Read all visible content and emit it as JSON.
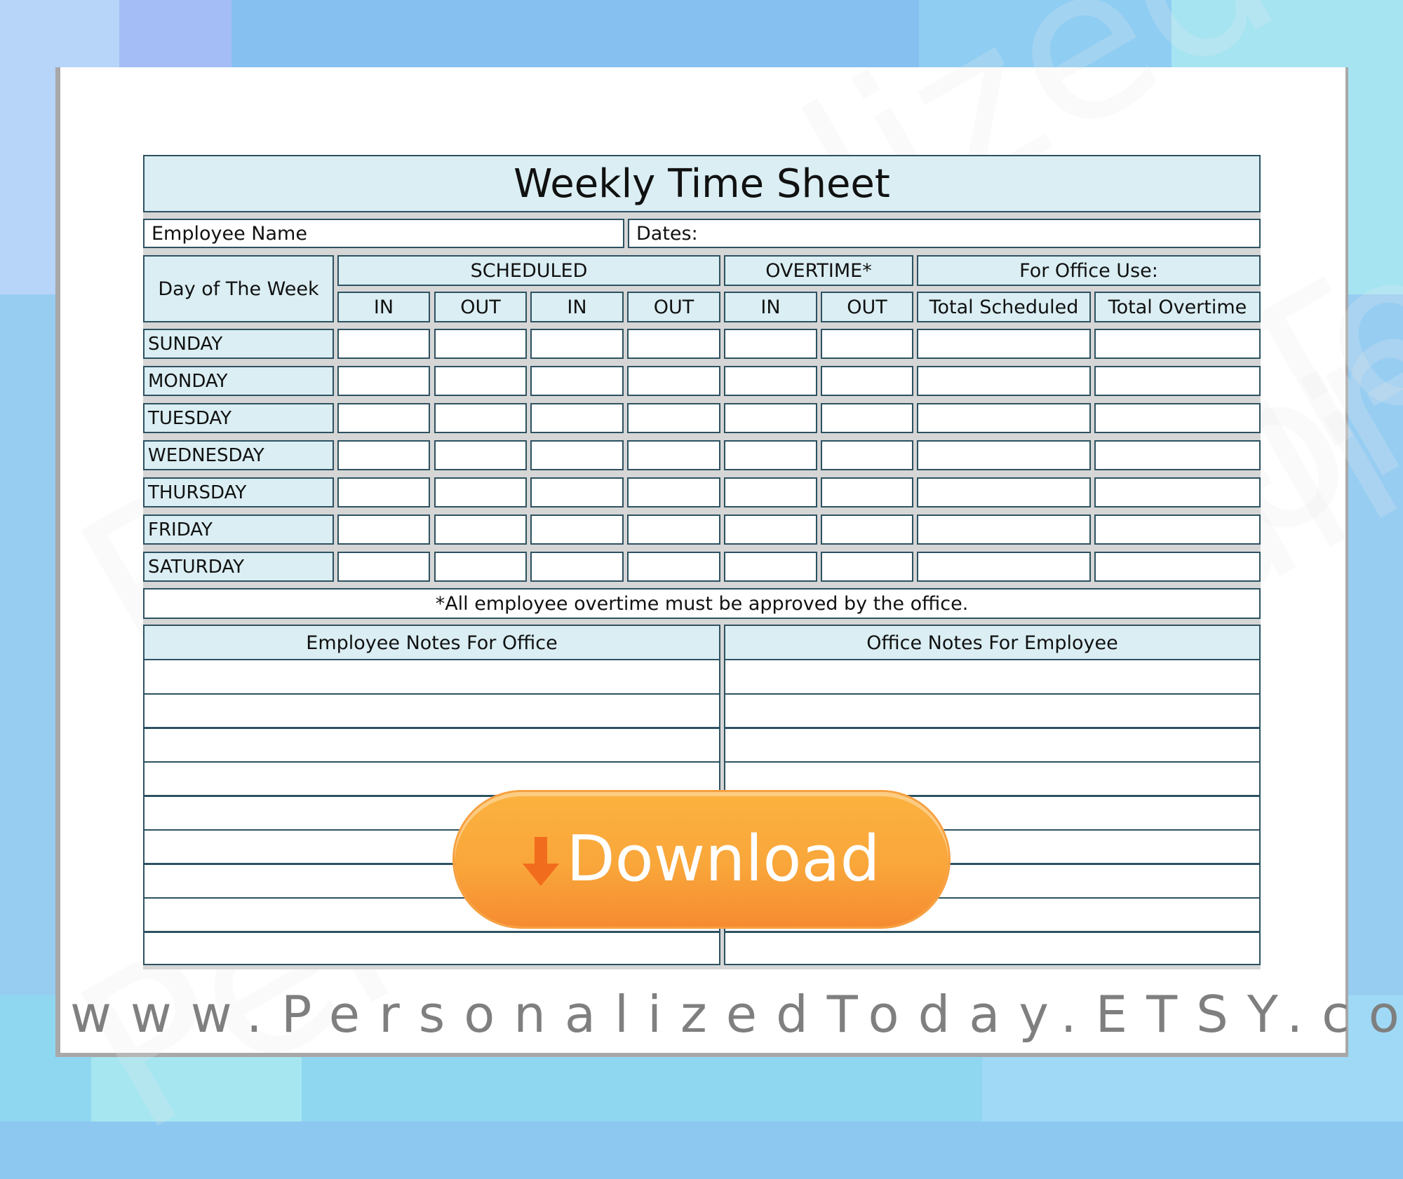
{
  "sheet": {
    "title": "Weekly Time Sheet",
    "employee_name_label": "Employee Name",
    "dates_label": "Dates:",
    "day_header": "Day of The Week",
    "groups": {
      "scheduled": "SCHEDULED",
      "overtime": "OVERTIME*",
      "office_use": "For Office Use:"
    },
    "columns": [
      "IN",
      "OUT",
      "IN",
      "OUT",
      "IN",
      "OUT",
      "Total Scheduled",
      "Total Overtime"
    ],
    "days": [
      "SUNDAY",
      "MONDAY",
      "TUESDAY",
      "WEDNESDAY",
      "THURSDAY",
      "FRIDAY",
      "SATURDAY"
    ],
    "footnote": "*All employee overtime must be approved by the office.",
    "notes": {
      "left_header": "Employee Notes For Office",
      "right_header": "Office Notes For Employee",
      "line_count": 9
    }
  },
  "download_button": {
    "label": "Download",
    "icon": "download-arrow-icon",
    "color": "#f9a63a",
    "arrow_color": "#f26c1d"
  },
  "watermark": "PersonalizedToday",
  "footer_url": "www.PersonalizedToday.ETSY.com",
  "colors": {
    "header_fill": "#daeef3",
    "border": "#2d5261",
    "gap": "#d6d6d6",
    "url_text": "#7f7f7f"
  }
}
